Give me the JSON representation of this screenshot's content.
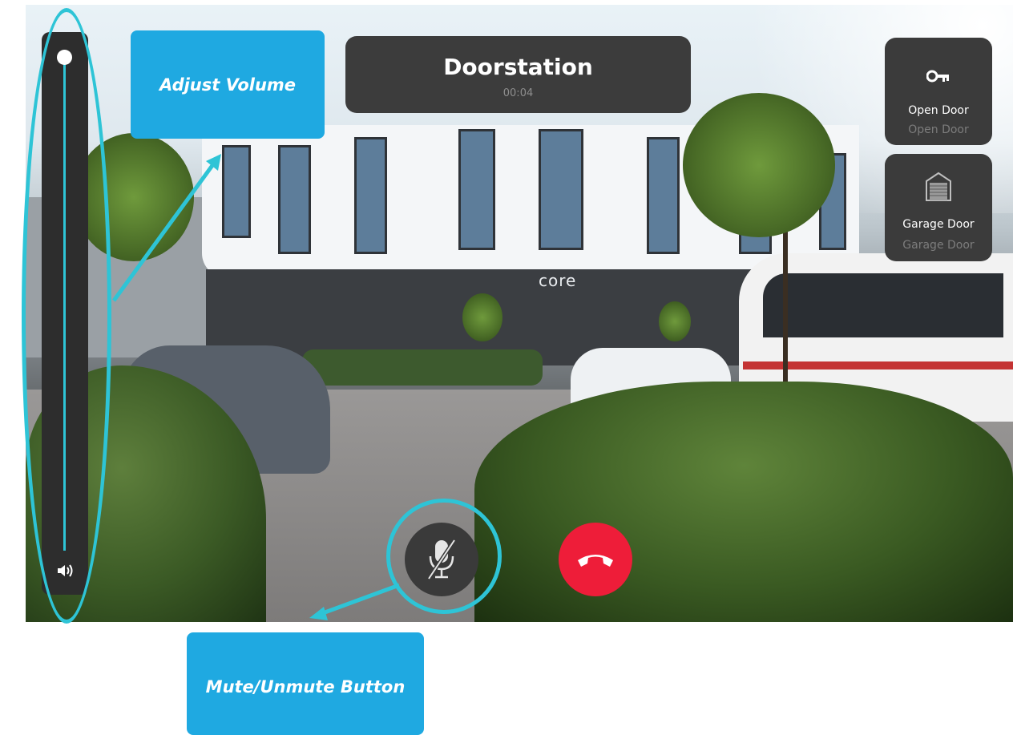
{
  "call": {
    "title": "Doorstation",
    "timer": "00:04"
  },
  "doors": [
    {
      "label": "Open Door",
      "sub": "Open Door",
      "icon": "key-icon"
    },
    {
      "label": "Garage Door",
      "sub": "Garage Door",
      "icon": "garage-door-icon"
    }
  ],
  "camera": {
    "sign_text": "core"
  },
  "volume": {
    "level": 1.0,
    "icon": "speaker-icon"
  },
  "controls": {
    "mute_icon": "microphone-muted-icon",
    "hangup_icon": "phone-hangup-icon",
    "hangup_color": "#ee1d39"
  },
  "annotations": {
    "volume_label": "Adjust Volume",
    "mute_label": "Mute/Unmute Button",
    "accent_color": "#2ec4d6",
    "callout_color": "#1fa9e1"
  }
}
